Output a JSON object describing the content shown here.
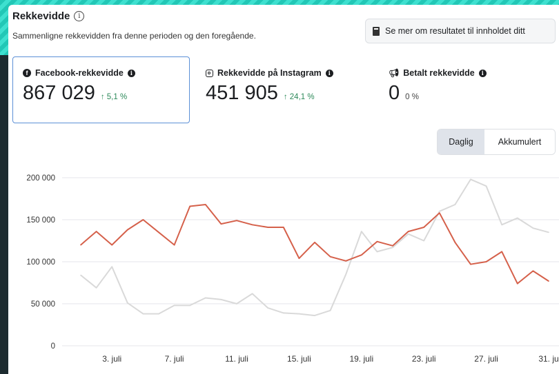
{
  "header": {
    "title": "Rekkevidde",
    "subtitle": "Sammenligne rekkevidden fra denne perioden og den foregående."
  },
  "more_button": {
    "label": "Se mer om resultatet til innholdet ditt"
  },
  "metrics": [
    {
      "label": "Facebook-rekkevidde",
      "value": "867 029",
      "change": "↑ 5,1 %"
    },
    {
      "label": "Rekkevidde på Instagram",
      "value": "451 905",
      "change": "↑ 24,1 %"
    },
    {
      "label": "Betalt rekkevidde",
      "value": "0",
      "change": "0 %"
    }
  ],
  "toggle": {
    "options": [
      "Daglig",
      "Akkumulert"
    ],
    "selected": "Daglig"
  },
  "colors": {
    "current": "#d5604a",
    "previous": "#d9d9d9",
    "selected_border": "#5b8fd6",
    "positive": "#2d8a5a"
  },
  "chart_data": {
    "type": "line",
    "x_labels": [
      "3. juli",
      "7. juli",
      "11. juli",
      "15. juli",
      "19. juli",
      "23. juli",
      "27. juli",
      "31. ju"
    ],
    "y_ticks": [
      "200 000",
      "150 000",
      "100 000",
      "50 000",
      "0"
    ],
    "ylim": [
      0,
      200000
    ],
    "grid": true,
    "series": [
      {
        "values": [
          120000,
          136000,
          120000,
          138000,
          150000,
          135000,
          120000,
          166000,
          168000,
          145000,
          149000,
          144000,
          141000,
          141000,
          104000,
          123000,
          106000,
          101000,
          108000,
          124000,
          119000,
          136000,
          141000,
          158000,
          123000,
          97000,
          100000,
          112000,
          74000,
          89000,
          77000
        ]
      },
      {
        "values": [
          84000,
          69000,
          94000,
          51000,
          38000,
          38000,
          48000,
          48000,
          57000,
          55000,
          50000,
          62000,
          45000,
          39000,
          38000,
          36000,
          42000,
          85000,
          136000,
          112000,
          117000,
          133000,
          125000,
          160000,
          168000,
          198000,
          190000,
          144000,
          152000,
          140000,
          135000
        ]
      }
    ]
  }
}
